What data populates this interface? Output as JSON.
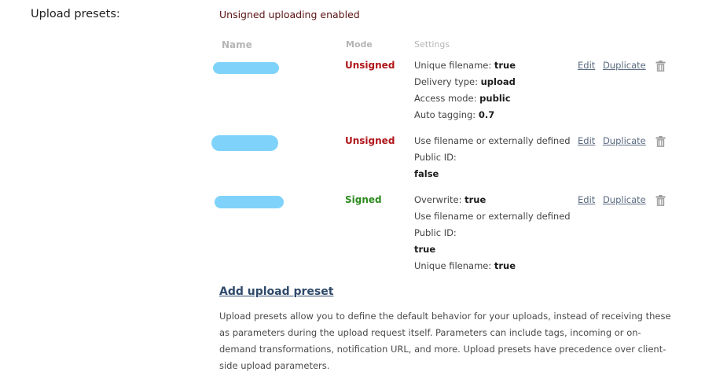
{
  "section_label": "Upload presets:",
  "status_title": "Unsigned uploading enabled",
  "table": {
    "headers": {
      "name": "Name",
      "mode": "Mode",
      "settings": "Settings"
    },
    "rows": [
      {
        "mode": "Unsigned",
        "mode_kind": "unsigned",
        "settings": [
          {
            "label": "Unique filename:",
            "value": "true"
          },
          {
            "label": "Delivery type:",
            "value": "upload"
          },
          {
            "label": "Access mode:",
            "value": "public"
          },
          {
            "label": "Auto tagging:",
            "value": "0.7"
          }
        ],
        "edit": "Edit",
        "duplicate": "Duplicate"
      },
      {
        "mode": "Unsigned",
        "mode_kind": "unsigned",
        "settings": [
          {
            "label": "Use filename or externally defined",
            "value": ""
          },
          {
            "label": "Public ID:",
            "value": ""
          },
          {
            "label": "",
            "value": "false"
          }
        ],
        "edit": "Edit",
        "duplicate": "Duplicate"
      },
      {
        "mode": "Signed",
        "mode_kind": "signed",
        "settings": [
          {
            "label": "Overwrite:",
            "value": "true"
          },
          {
            "label": "Use filename or externally defined",
            "value": ""
          },
          {
            "label": "Public ID:",
            "value": ""
          },
          {
            "label": "",
            "value": "true"
          },
          {
            "label": "Unique filename:",
            "value": "true"
          }
        ],
        "edit": "Edit",
        "duplicate": "Duplicate"
      }
    ]
  },
  "add_preset_label": "Add upload preset",
  "description": "Upload presets allow you to define the default behavior for your uploads, instead of receiving these as parameters during the upload request itself. Parameters can include tags, incoming or on-demand transformations, notification URL, and more. Upload presets have precedence over client-side upload parameters.",
  "colors": {
    "unsigned": "#b0161b",
    "signed": "#2e8a1f",
    "redacted_name": "#7fd3fa",
    "link": "#2f4a6b"
  },
  "icons": {
    "delete": "trash-icon"
  }
}
